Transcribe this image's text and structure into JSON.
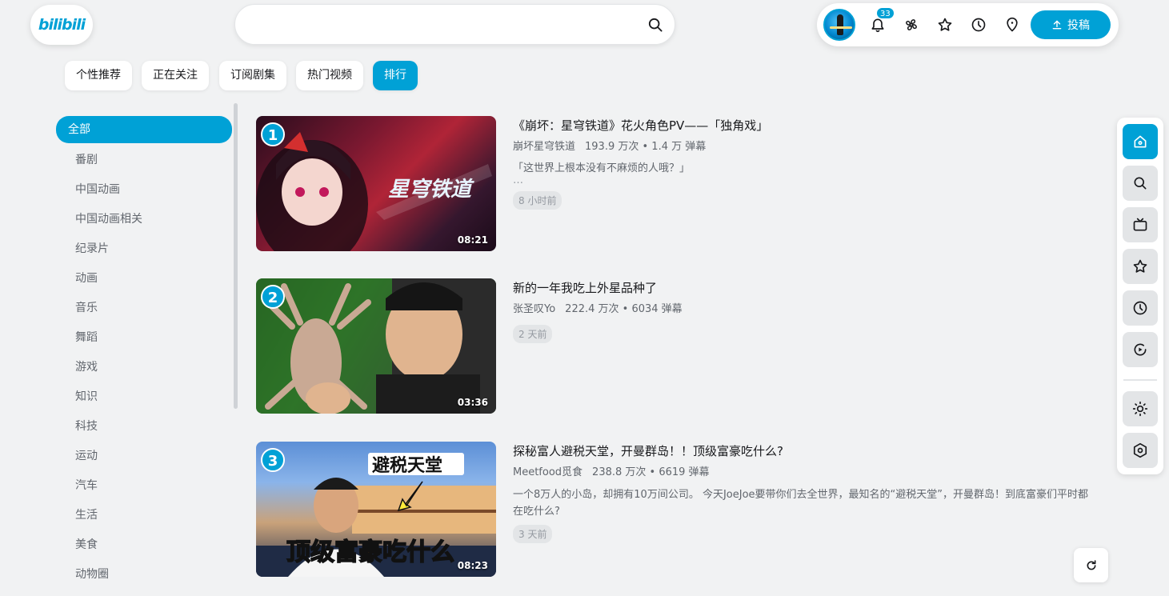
{
  "app": {
    "logo_text": "bilibili",
    "brand_color": "#00a1d6"
  },
  "search": {
    "placeholder": "",
    "value": ""
  },
  "header": {
    "notification_count": "33",
    "upload_label": "投稿",
    "icons": [
      "bell-icon",
      "fan-icon",
      "star-icon",
      "clock-icon",
      "location-icon"
    ]
  },
  "tabs": [
    {
      "label": "个性推荐",
      "active": false
    },
    {
      "label": "正在关注",
      "active": false
    },
    {
      "label": "订阅剧集",
      "active": false
    },
    {
      "label": "热门视频",
      "active": false
    },
    {
      "label": "排行",
      "active": true
    }
  ],
  "categories": [
    {
      "label": "全部",
      "active": true
    },
    {
      "label": "番剧"
    },
    {
      "label": "中国动画"
    },
    {
      "label": "中国动画相关"
    },
    {
      "label": "纪录片"
    },
    {
      "label": "动画"
    },
    {
      "label": "音乐"
    },
    {
      "label": "舞蹈"
    },
    {
      "label": "游戏"
    },
    {
      "label": "知识"
    },
    {
      "label": "科技"
    },
    {
      "label": "运动"
    },
    {
      "label": "汽车"
    },
    {
      "label": "生活"
    },
    {
      "label": "美食"
    },
    {
      "label": "动物圈"
    }
  ],
  "videos": [
    {
      "rank": "1",
      "duration": "08:21",
      "title": "《崩坏：星穹铁道》花火角色PV——「独角戏」",
      "author": "崩坏星穹铁道",
      "stats": "193.9 万次 • 1.4 万 弹幕",
      "desc": "「这世界上根本没有不麻烦的人哦？」",
      "desc_more": "…",
      "time": "8 小时前",
      "thumb_text": "星穹铁道"
    },
    {
      "rank": "2",
      "duration": "03:36",
      "title": "新的一年我吃上外星品种了",
      "author": "张圣叹Yo",
      "stats": "222.4 万次 • 6034 弹幕",
      "desc": "",
      "time": "2 天前"
    },
    {
      "rank": "3",
      "duration": "08:23",
      "title": "探秘富人避税天堂，开曼群岛！！顶级富豪吃什么?",
      "author": "Meetfood觅食",
      "stats": "238.8 万次 • 6619 弹幕",
      "desc": "一个8万人的小岛，却拥有10万间公司。 今天JoeJoe要带你们去全世界，最知名的“避税天堂”，开曼群岛！到底富豪们平时都在吃什么?",
      "time": "3 天前",
      "thumb_text_top": "避税天堂",
      "thumb_text_bottom": "顶级富豪吃什么"
    }
  ],
  "sidebar": {
    "buttons": [
      "home-icon",
      "search-icon",
      "tv-icon",
      "star-icon",
      "clock-icon",
      "replay-icon",
      "sun-icon",
      "gear-icon"
    ]
  },
  "refresh": {
    "icon": "refresh-icon"
  }
}
